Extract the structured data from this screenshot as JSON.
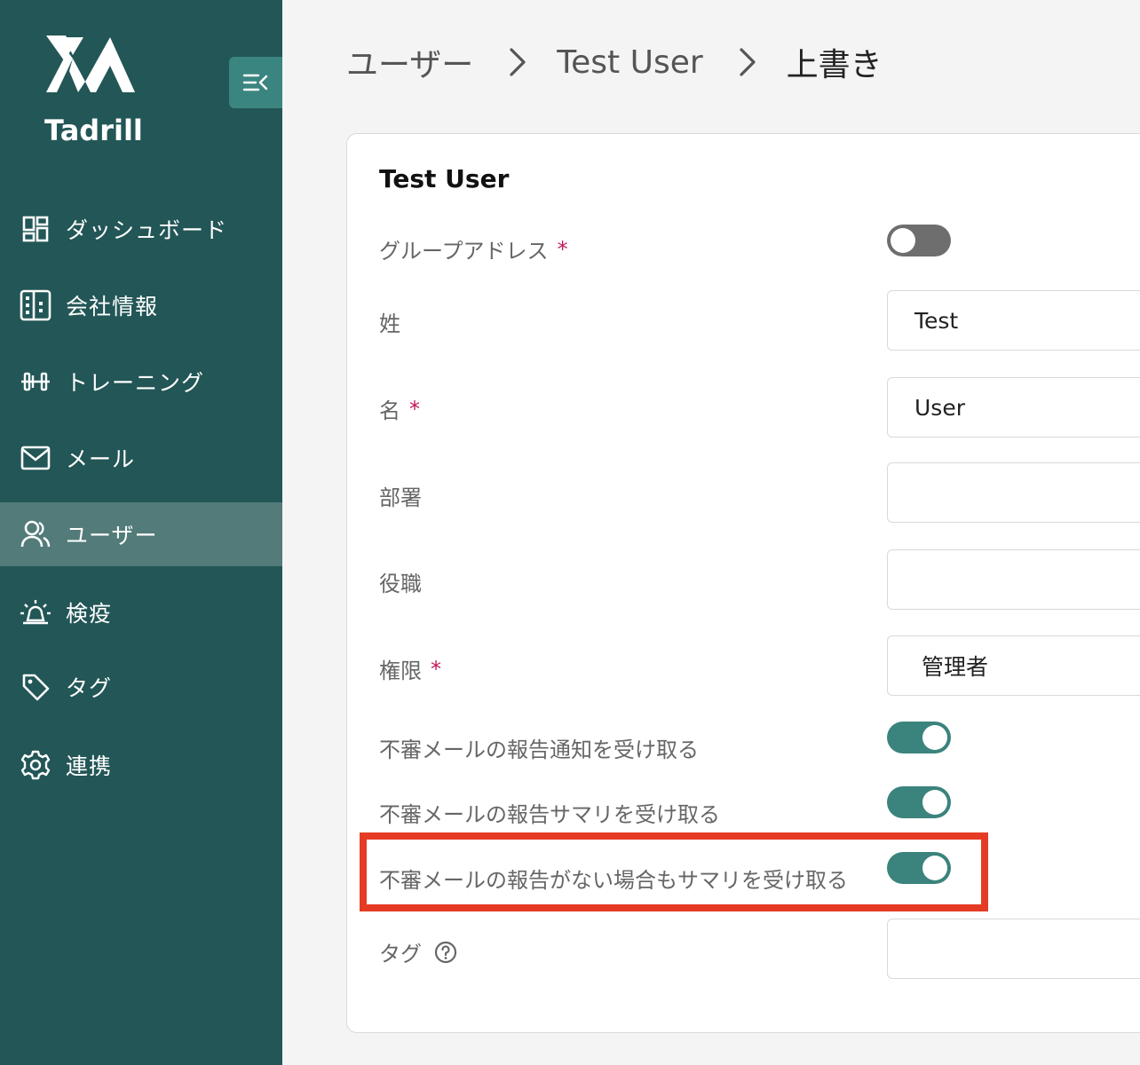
{
  "sidebar": {
    "logo_text": "Tadrill",
    "items": [
      {
        "label": "ダッシュボード",
        "icon": "dashboard-icon"
      },
      {
        "label": "会社情報",
        "icon": "building-icon"
      },
      {
        "label": "トレーニング",
        "icon": "dumbbell-icon"
      },
      {
        "label": "メール",
        "icon": "mail-icon"
      },
      {
        "label": "ユーザー",
        "icon": "users-icon",
        "active": true
      },
      {
        "label": "検疫",
        "icon": "siren-icon"
      },
      {
        "label": "タグ",
        "icon": "tag-icon"
      },
      {
        "label": "連携",
        "icon": "gear-icon"
      }
    ]
  },
  "breadcrumb": {
    "level1": "ユーザー",
    "level2": "Test User",
    "current": "上書き"
  },
  "card": {
    "title": "Test User",
    "fields": {
      "group_address": {
        "label": "グループアドレス",
        "required": "*",
        "enabled": false
      },
      "last_name": {
        "label": "姓",
        "value": "Test"
      },
      "first_name": {
        "label": "名",
        "required": "*",
        "value": "User"
      },
      "department": {
        "label": "部署",
        "value": ""
      },
      "position": {
        "label": "役職",
        "value": ""
      },
      "role": {
        "label": "権限",
        "required": "*",
        "value": "管理者"
      },
      "report_notify": {
        "label": "不審メールの報告通知を受け取る",
        "enabled": true
      },
      "report_summary": {
        "label": "不審メールの報告サマリを受け取る",
        "enabled": true
      },
      "summary_no_reports": {
        "label": "不審メールの報告がない場合もサマリを受け取る",
        "enabled": true
      },
      "tags": {
        "label": "タグ",
        "value": ""
      }
    }
  },
  "colors": {
    "sidebar_bg": "#235656",
    "sidebar_active": "#527b79",
    "accent": "#3b837d",
    "highlight": "#e53b24",
    "required": "#c2185b"
  }
}
